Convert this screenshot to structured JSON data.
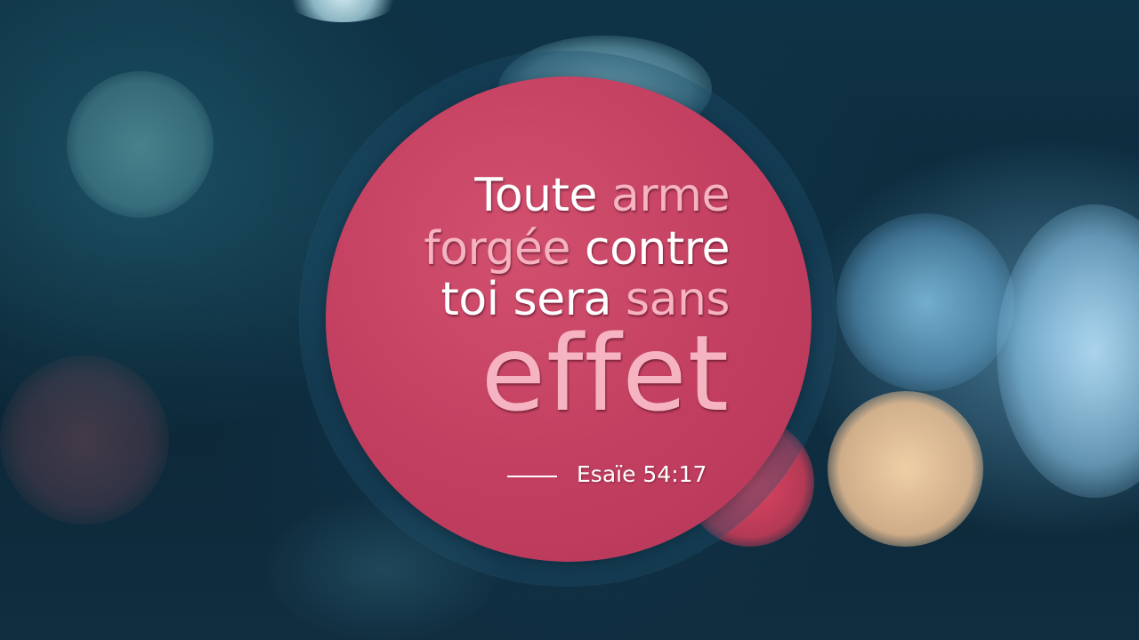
{
  "quote": {
    "line1": {
      "a": "Toute ",
      "b": "arme"
    },
    "line2": {
      "a": "forgée ",
      "b": "contre"
    },
    "line3": {
      "a": "toi sera ",
      "b": "sans"
    },
    "line4": "effet"
  },
  "reference": "Esaïe 54:17",
  "colors": {
    "disc": "#c23e60",
    "text_white": "#ffffff",
    "text_pink": "#f6b3c2",
    "background": "#0d2a3c"
  }
}
